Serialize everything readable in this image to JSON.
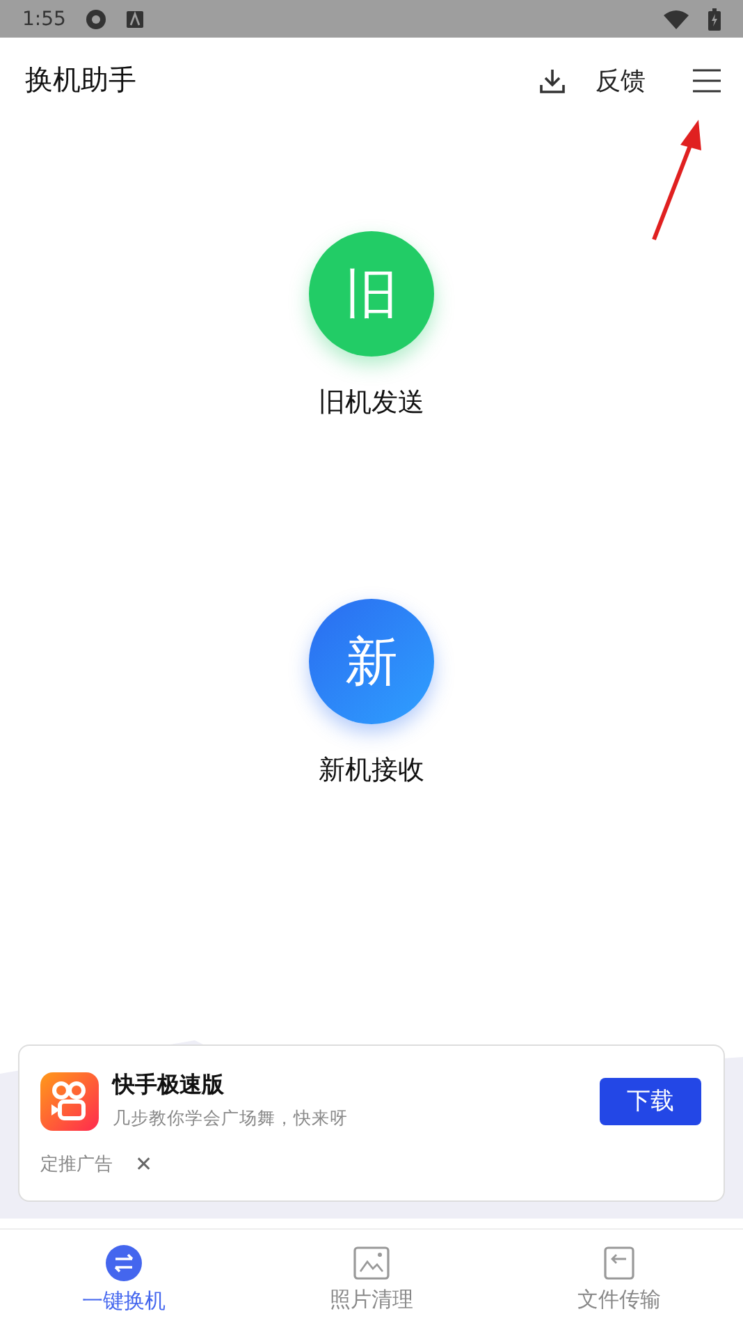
{
  "status_bar": {
    "time": "1:55"
  },
  "app_bar": {
    "title": "换机助手",
    "feedback": "反馈"
  },
  "actions": [
    {
      "kind": "old",
      "glyph": "旧",
      "label": "旧机发送"
    },
    {
      "kind": "new",
      "glyph": "新",
      "label": "新机接收"
    }
  ],
  "ad": {
    "app_name": "快手极速版",
    "description": "几步教你学会广场舞，快来呀",
    "button": "下载",
    "tag": "定推广告",
    "close": "✕"
  },
  "tabs": [
    {
      "kind": "switch",
      "label": "一键换机",
      "selected": true
    },
    {
      "kind": "photo",
      "label": "照片清理",
      "selected": false
    },
    {
      "kind": "file",
      "label": "文件传输",
      "selected": false
    }
  ]
}
